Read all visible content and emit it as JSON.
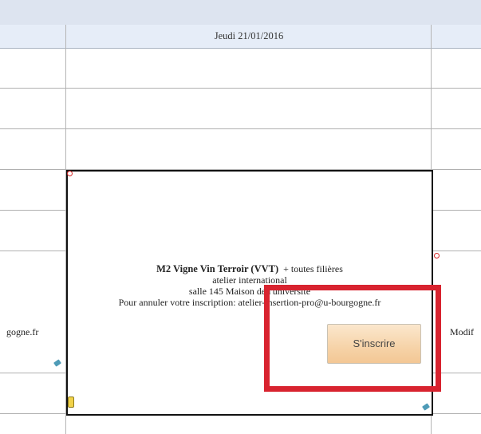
{
  "calendar": {
    "day_header": "Jeudi 21/01/2016",
    "left_fragment": "gogne.fr",
    "right_fragment": "Modif"
  },
  "event": {
    "title": "M2 Vigne Vin Terroir (VVT)",
    "title_suffix": "+ toutes filières",
    "line2": "atelier international",
    "line3": "salle 145 Maison de l'université",
    "line4": "Pour annuler votre inscription: atelier-insertion-pro@u-bourgogne.fr",
    "register_button": "S'inscrire"
  },
  "colors": {
    "highlight": "#d8232f",
    "header_bg": "#e6edf8",
    "button_bg": "#f6d3a8"
  },
  "icons": [
    "resize-handle-icon",
    "note-icon",
    "drag-handle-icon"
  ]
}
